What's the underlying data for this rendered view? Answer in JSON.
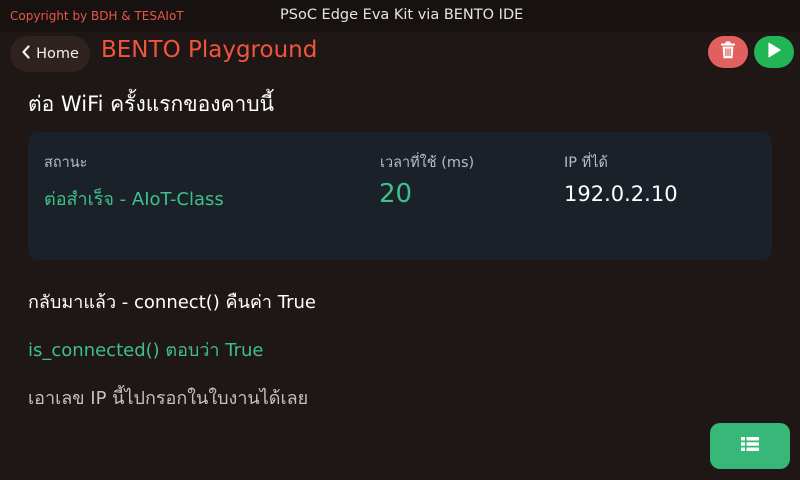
{
  "header": {
    "copyright": "Copyright by BDH & TESAIoT",
    "kit_title": "PSoC Edge Eva Kit via BENTO IDE"
  },
  "nav": {
    "back_icon": "chevron-left-icon",
    "home_label": "Home",
    "app_title": "BENTO Playground",
    "delete_icon": "trash-icon",
    "run_icon": "play-icon"
  },
  "main": {
    "title": "ต่อ WiFi ครั้งแรกของคาบนี้",
    "stats": {
      "status_label": "สถานะ",
      "status_value": "ต่อสำเร็จ - AIoT-Class",
      "time_label": "เวลาที่ใช้ (ms)",
      "time_value": "20",
      "ip_label": "IP ที่ได้",
      "ip_value": "192.0.2.10"
    },
    "lines": [
      "กลับมาแล้ว - connect() คืนค่า True",
      "is_connected() ตอบว่า True",
      "เอาเลข IP นี้ไปกรอกในใบงานได้เลย"
    ]
  },
  "fab": {
    "icon": "list-icon"
  },
  "colors": {
    "background": "#1e1715",
    "accent_red": "#f0553f",
    "success_green": "#3ec089",
    "play_green": "#21b555",
    "delete_red": "#e25f5f",
    "panel": "#1a2129"
  }
}
